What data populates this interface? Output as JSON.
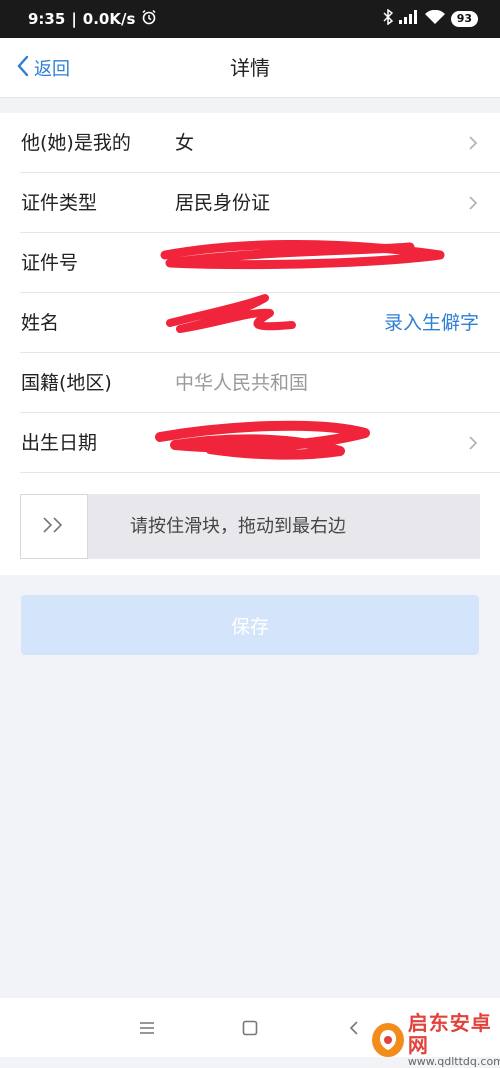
{
  "status_bar": {
    "time": "9:35",
    "speed": "0.0K/s",
    "battery": "93",
    "icons": [
      "alarm-icon",
      "bluetooth-icon",
      "signal-icon",
      "wifi-icon",
      "battery-icon"
    ]
  },
  "nav": {
    "back_label": "返回",
    "title": "详情"
  },
  "form": {
    "rows": [
      {
        "label": "他(她)是我的",
        "value": "女"
      },
      {
        "label": "证件类型",
        "value": "居民身份证"
      },
      {
        "label": "证件号",
        "value": ""
      },
      {
        "label": "姓名",
        "value": "",
        "action": "录入生僻字"
      },
      {
        "label": "国籍(地区)",
        "value": "中华人民共和国"
      },
      {
        "label": "出生日期",
        "value": ""
      }
    ]
  },
  "slider": {
    "text": "请按住滑块，拖动到最右边"
  },
  "save_label": "保存",
  "watermark": {
    "title": "启东安卓网",
    "url": "www.qdlttdq.com"
  },
  "colors": {
    "accent": "#2f7fd6",
    "save_button_bg": "#d4e4fa",
    "redaction": "#f0243a",
    "page_bg": "#f2f3f7"
  }
}
